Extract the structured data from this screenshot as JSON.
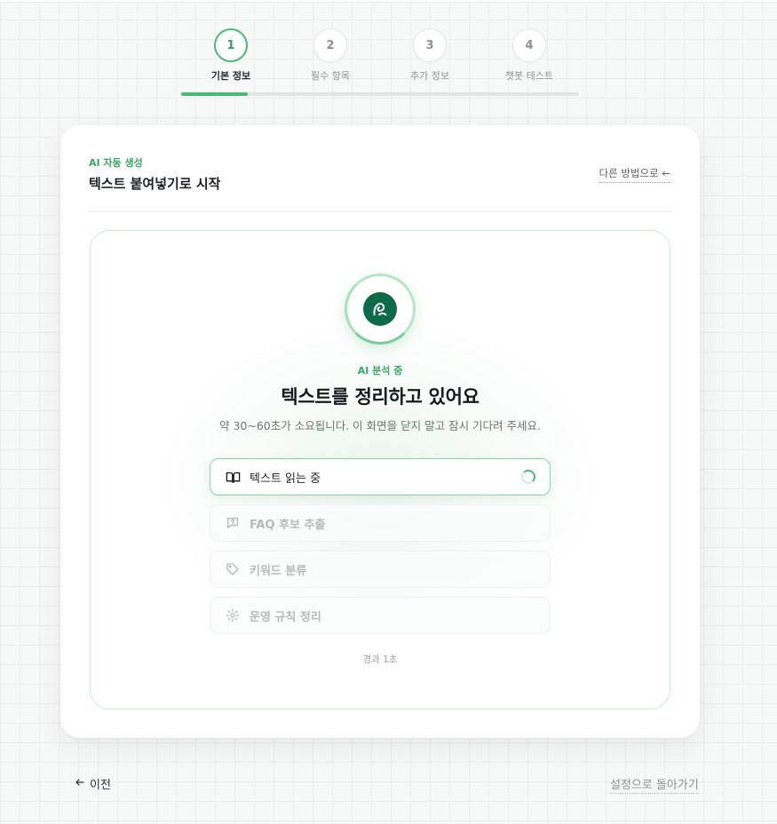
{
  "stepper": {
    "steps": [
      {
        "number": "1",
        "label": "기본 정보"
      },
      {
        "number": "2",
        "label": "필수 항목"
      },
      {
        "number": "3",
        "label": "추가 정보"
      },
      {
        "number": "4",
        "label": "챗봇 테스트"
      }
    ],
    "active_step": 1,
    "progress_fraction": 0.167
  },
  "card": {
    "eyebrow": "AI 자동 생성",
    "title": "텍스트 붙여넣기로 시작",
    "other_method": "다른 방법으로 ←"
  },
  "analysis": {
    "logo_icon": "brand-logo-icon",
    "status": "AI 분석 중",
    "heading": "텍스트를 정리하고 있어요",
    "subtext": "약 30~60초가 소요됩니다. 이 화면을 닫지 말고 잠시 기다려 주세요.",
    "tasks": [
      {
        "label": "텍스트 읽는 중",
        "icon": "book-icon",
        "state": "active"
      },
      {
        "label": "FAQ 후보 추출",
        "icon": "message-question-icon",
        "state": "pending"
      },
      {
        "label": "키워드 분류",
        "icon": "tag-icon",
        "state": "pending"
      },
      {
        "label": "운영 규칙 정리",
        "icon": "gear-icon",
        "state": "pending"
      }
    ],
    "elapsed": "경과 1초"
  },
  "footer": {
    "prev_label": "이전",
    "back_label": "설정으로 돌아가기"
  },
  "colors": {
    "accent": "#4cb877",
    "accent_dark": "#3aa764",
    "logo_bg": "#0e6b4a"
  }
}
